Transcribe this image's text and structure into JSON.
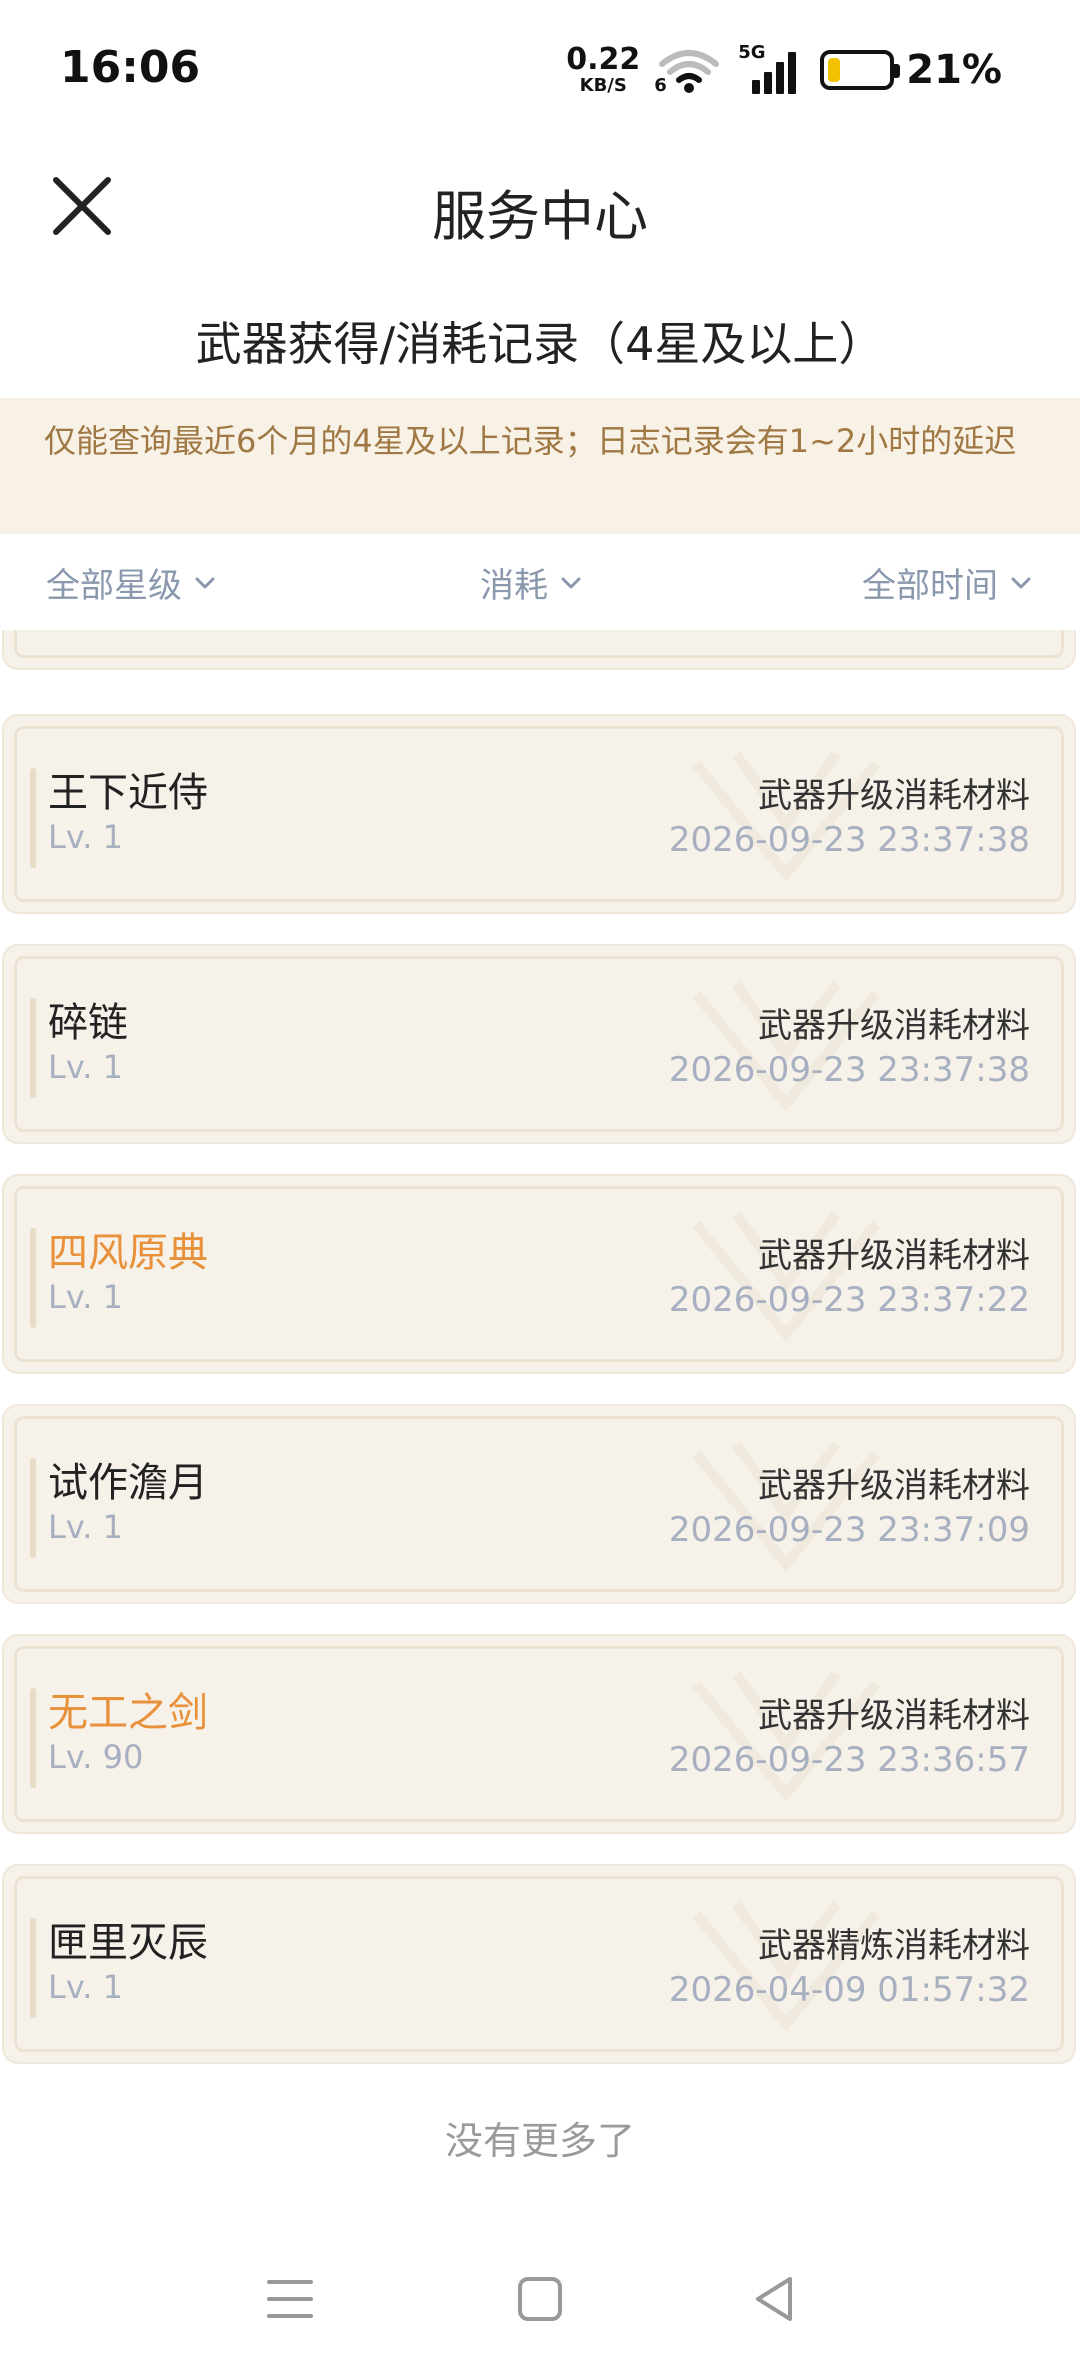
{
  "status_bar": {
    "time": "16:06",
    "net_speed": "0.22",
    "net_unit": "KB/S",
    "wifi_sub": "6",
    "signal_tag": "5G",
    "battery_pct": "21%",
    "battery_level": 0.21
  },
  "header": {
    "title": "服务中心",
    "close_icon": "close-icon"
  },
  "subtitle": "武器获得/消耗记录（4星及以上）",
  "notice": "仅能查询最近6个月的4星及以上记录；日志记录会有1~2小时的延迟",
  "filters": {
    "star": "全部星级",
    "type": "消耗",
    "time": "全部时间"
  },
  "records": [
    {
      "name": "王下近侍",
      "level": "Lv. 1",
      "type": "武器升级消耗材料",
      "time": "2026-09-23 23:37:38",
      "highlight": false
    },
    {
      "name": "碎链",
      "level": "Lv. 1",
      "type": "武器升级消耗材料",
      "time": "2026-09-23 23:37:38",
      "highlight": false
    },
    {
      "name": "四风原典",
      "level": "Lv. 1",
      "type": "武器升级消耗材料",
      "time": "2026-09-23 23:37:22",
      "highlight": true
    },
    {
      "name": "试作澹月",
      "level": "Lv. 1",
      "type": "武器升级消耗材料",
      "time": "2026-09-23 23:37:09",
      "highlight": false
    },
    {
      "name": "无工之剑",
      "level": "Lv. 90",
      "type": "武器升级消耗材料",
      "time": "2026-09-23 23:36:57",
      "highlight": true
    },
    {
      "name": "匣里灭辰",
      "level": "Lv. 1",
      "type": "武器精炼消耗材料",
      "time": "2026-04-09 01:57:32",
      "highlight": false
    }
  ],
  "footer": {
    "no_more": "没有更多了"
  },
  "colors": {
    "gold": "#e8913a",
    "card_bg": "#f6f1e9",
    "notice_bg": "#f7f1e6",
    "notice_text": "#a07844"
  }
}
